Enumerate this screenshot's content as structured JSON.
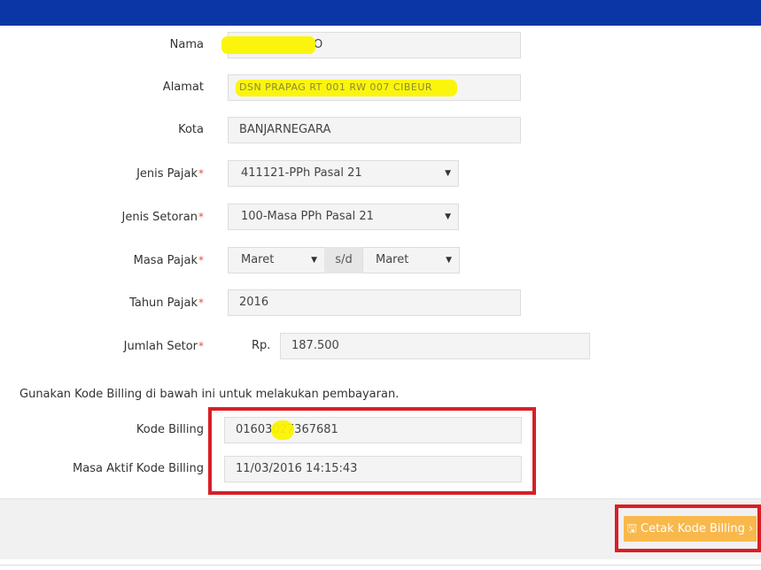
{
  "form": {
    "nama": {
      "label": "Nama",
      "value_suffix": "O"
    },
    "alamat": {
      "label": "Alamat",
      "value_obscured": "DSN PRAPAG RT 001 RW 007 CIBEUR"
    },
    "kota": {
      "label": "Kota",
      "value": "BANJARNEGARA"
    },
    "jenis_pajak": {
      "label": "Jenis Pajak",
      "value": "411121-PPh Pasal 21"
    },
    "jenis_setoran": {
      "label": "Jenis Setoran",
      "value": "100-Masa PPh Pasal 21"
    },
    "masa_pajak": {
      "label": "Masa Pajak",
      "from": "Maret",
      "separator": "s/d",
      "to": "Maret"
    },
    "tahun_pajak": {
      "label": "Tahun Pajak",
      "value": "2016"
    },
    "jumlah_setor": {
      "label": "Jumlah Setor",
      "currency": "Rp.",
      "value": "187.500"
    },
    "required_marker": "*"
  },
  "billing": {
    "note": "Gunakan Kode Billing di bawah ini untuk melakukan pembayaran.",
    "kode_label": "Kode Billing",
    "kode_value": "01603027367681",
    "masa_aktif_label": "Masa Aktif Kode Billing",
    "masa_aktif_value": "11/03/2016 14:15:43"
  },
  "footer": {
    "print_button": "Cetak Kode Billing",
    "print_icon": "save-icon",
    "chevron_icon": "chevron-right-icon"
  },
  "colors": {
    "topbar": "#0a36a6",
    "highlight": "#fbf400",
    "annotation_red": "#d81f26",
    "button": "#f9b84b"
  }
}
